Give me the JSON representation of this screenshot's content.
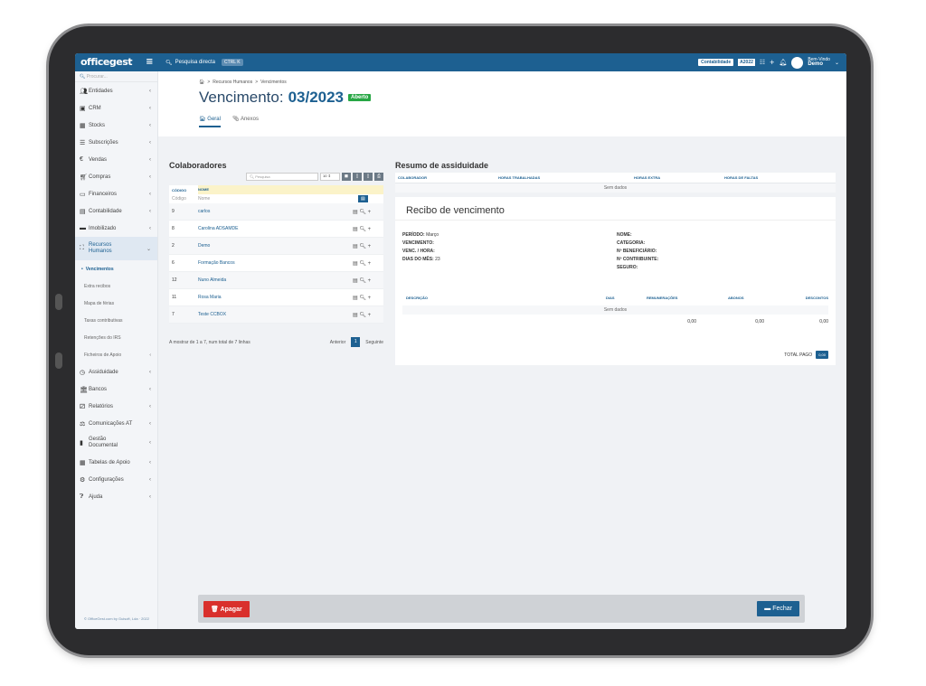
{
  "topbar": {
    "logo": "officegest",
    "search_label": "Pesquisa directa",
    "shortcut": "CTRL K",
    "company": "Contabilidade",
    "year": "A2022",
    "user_greeting": "Bem-Vindo",
    "user_name": "Demo"
  },
  "sidebar": {
    "search_placeholder": "Procurar...",
    "items": [
      {
        "label": "Entidades",
        "icon": "users-icon"
      },
      {
        "label": "CRM",
        "icon": "briefcase-icon"
      },
      {
        "label": "Stocks",
        "icon": "warehouse-icon"
      },
      {
        "label": "Subscrições",
        "icon": "list-icon"
      },
      {
        "label": "Vendas",
        "icon": "euro-icon"
      },
      {
        "label": "Compras",
        "icon": "cart-icon"
      },
      {
        "label": "Financeiros",
        "icon": "money-icon"
      },
      {
        "label": "Contabilidade",
        "icon": "calculator-icon"
      },
      {
        "label": "Imobilizado",
        "icon": "building-icon"
      },
      {
        "label": "Recursos Humanos",
        "icon": "org-icon"
      }
    ],
    "sub_items": [
      "Vencimentos",
      "Extra recibos",
      "Mapa de férias",
      "Taxas contributivas",
      "Retenções do IRS",
      "Ficheiros de Apoio"
    ],
    "items2": [
      {
        "label": "Assiduidade",
        "icon": "clock-icon"
      },
      {
        "label": "Bancos",
        "icon": "bank-icon"
      },
      {
        "label": "Relatórios",
        "icon": "chart-icon"
      },
      {
        "label": "Comunicações AT",
        "icon": "tax-icon"
      },
      {
        "label": "Gestão Documental",
        "icon": "document-icon"
      },
      {
        "label": "Tabelas de Apoio",
        "icon": "table-icon"
      },
      {
        "label": "Configurações",
        "icon": "cogs-icon"
      },
      {
        "label": "Ajuda",
        "icon": "help-icon"
      }
    ],
    "footer": "© OfficeGest.com by Guisoft, Lda · 2022"
  },
  "header": {
    "breadcrumb": [
      "Recursos Humanos",
      "Vencimentos"
    ],
    "title": "Vencimento:",
    "title_value": "03/2023",
    "status": "Aberto",
    "tabs": [
      "Geral",
      "Anexos"
    ]
  },
  "colaboradores": {
    "title": "Colaboradores",
    "search_placeholder": "Pesquisa",
    "page_size": "10",
    "col_code": "CÓDIGO",
    "col_name": "NOME",
    "filter_code": "Código",
    "filter_name": "Nome",
    "rows": [
      {
        "code": "9",
        "name": "carlos"
      },
      {
        "code": "8",
        "name": "Carolina ADSAMDE"
      },
      {
        "code": "2",
        "name": "Demo"
      },
      {
        "code": "6",
        "name": "Formação Bancos"
      },
      {
        "code": "12",
        "name": "Nuno Almeida"
      },
      {
        "code": "11",
        "name": "Rosa Maria"
      },
      {
        "code": "7",
        "name": "Teste CCBOX"
      }
    ],
    "footer_info": "A mostrar de 1 a 7, num total de 7 linhas",
    "prev": "Anterior",
    "page": "1",
    "next": "Seguinte"
  },
  "assiduidade": {
    "title": "Resumo de assiduidade",
    "headers": [
      "COLABORADOR",
      "HORAS TRABALHADAS",
      "HORAS EXTRA",
      "HORAS DE FALTAS"
    ],
    "empty": "Sem dados"
  },
  "recibo": {
    "title": "Recibo de vencimento",
    "periodo_label": "PERÍODO:",
    "periodo": "Março",
    "vencimento_label": "VENCIMENTO:",
    "venc_hora_label": "VENC. / HORA:",
    "dias_label": "DIAS DO MÊS:",
    "dias": "23",
    "nome_label": "NOME:",
    "categoria_label": "CATEGORIA:",
    "beneficiario_label": "Nº BENEFICIÁRIO:",
    "contribuinte_label": "Nº CONTRIBUINTE:",
    "seguro_label": "SEGURO:",
    "headers": [
      "DESCRIÇÃO",
      "DIAS",
      "REMUNERAÇÕES",
      "ABONOS",
      "DESCONTOS"
    ],
    "empty": "Sem dados",
    "totals": [
      "0,00",
      "0,00",
      "0,00"
    ],
    "total_label": "TOTAL PAGO",
    "total_value": "0,00"
  },
  "actions": {
    "delete": "Apagar",
    "close": "Fechar"
  },
  "colors": {
    "brand": "#1d6091",
    "success": "#28a745",
    "danger": "#d9302c"
  }
}
